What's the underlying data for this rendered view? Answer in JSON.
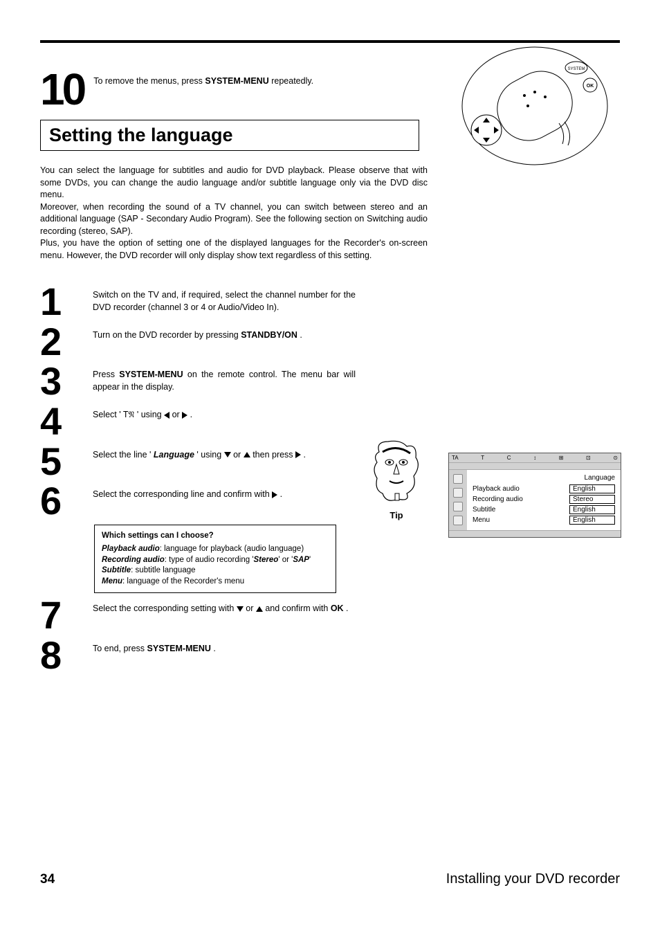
{
  "step10": {
    "num": "10",
    "text_pre": "To remove the menus, press ",
    "button": "SYSTEM-MENU",
    "text_post": " repeatedly."
  },
  "section_title": "Setting the language",
  "intro": {
    "p1": "You can select the language for subtitles and audio for DVD playback. Please observe that with some DVDs, you can change the audio language and/or subtitle language only via the DVD disc menu.",
    "p2": "Moreover, when recording the sound of a TV channel, you can switch between stereo and an additional language (SAP - Secondary Audio Program). See the following section on Switching audio recording (stereo, SAP).",
    "p3": "Plus, you have the option of setting one of the displayed languages for the Recorder's on-screen menu. However, the DVD recorder will only display show text regardless of this setting."
  },
  "steps": [
    {
      "num": "1",
      "pre": "Switch on the TV and, if required, select the channel number for the DVD recorder (channel 3 or 4 or Audio/Video In)."
    },
    {
      "num": "2",
      "pre": "Turn on the DVD recorder by pressing ",
      "btn": "STANDBY/ON",
      "post": " ."
    },
    {
      "num": "3",
      "pre": "Press ",
      "btn": "SYSTEM-MENU",
      "post": " on the remote control. The menu bar will appear in the display."
    },
    {
      "num": "4",
      "pre": "Select '",
      "icon": "tool",
      "post": "' using ",
      "arrows": "lr",
      "end": " ."
    },
    {
      "num": "5",
      "pre": "Select the line '",
      "em": "Language",
      "post": "' using ",
      "arrows": "du",
      "then": " then press ",
      "end_arrow": "r",
      "end": " ."
    },
    {
      "num": "6",
      "pre": "Select the corresponding line and confirm with ",
      "end_arrow": "r",
      "end": " ."
    },
    {
      "num": "7",
      "pre": "Select the corresponding setting with ",
      "arrows": "du",
      "post": " and confirm with ",
      "btn": "OK",
      "end": " ."
    },
    {
      "num": "8",
      "pre": "To end, press ",
      "btn": "SYSTEM-MENU",
      "end": " ."
    }
  ],
  "tip": {
    "title": "Which settings can I choose?",
    "l1a": "Playback audio",
    "l1b": ": language for playback (audio language)",
    "l2a": "Recording audio",
    "l2b": ": type of audio recording '",
    "l2c": "Stereo",
    "l2d": "' or '",
    "l2e": "SAP",
    "l2f": "'",
    "l3a": "Subtitle",
    "l3b": ": subtitle language",
    "l4a": "Menu",
    "l4b": ": language of the Recorder's menu",
    "label": "Tip"
  },
  "osd": {
    "topbar": [
      "TA",
      "T",
      "C",
      "↕",
      "⊞",
      "⊡",
      "⊙"
    ],
    "heading": "Language",
    "rows": [
      {
        "label": "Playback audio",
        "value": "English"
      },
      {
        "label": "Recording audio",
        "value": "Stereo"
      },
      {
        "label": "Subtitle",
        "value": "English"
      },
      {
        "label": "Menu",
        "value": "English"
      }
    ]
  },
  "remote": {
    "system": "SYSTEM",
    "ok": "OK"
  },
  "footer": {
    "page": "34",
    "title": "Installing your DVD recorder"
  }
}
